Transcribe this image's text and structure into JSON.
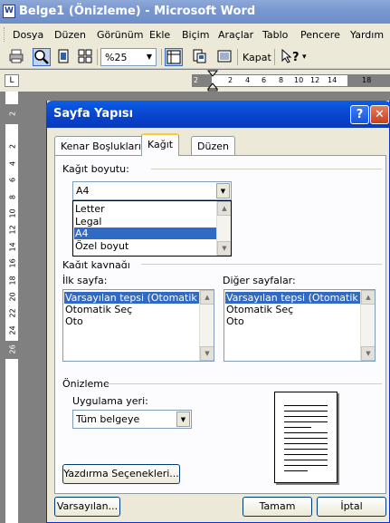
{
  "window": {
    "title": "Belge1 (Önizleme) - Microsoft Word",
    "icon": "word-app-icon"
  },
  "menu": [
    "Dosya",
    "Düzen",
    "Görünüm",
    "Ekle",
    "Biçim",
    "Araçlar",
    "Tablo",
    "Pencere",
    "Yardım"
  ],
  "toolbar": {
    "zoom": "%25",
    "close_label": "Kapat",
    "icons": [
      "print-icon",
      "magnifier-icon",
      "one-page-icon",
      "multiple-pages-icon",
      "view-ruler-icon",
      "shrink-to-fit-icon",
      "full-screen-icon",
      "context-help-icon"
    ]
  },
  "ruler": {
    "corner": "L",
    "numbers": [
      "2",
      "2",
      "4",
      "6",
      "8",
      "10",
      "12",
      "14",
      "18"
    ],
    "vnumbers": [
      "2",
      "2",
      "4",
      "6",
      "8",
      "10",
      "12",
      "14",
      "16",
      "18",
      "20",
      "22",
      "24",
      "26"
    ]
  },
  "dialog": {
    "title": "Sayfa Yapısı",
    "help": "?",
    "close": "✕",
    "tabs": [
      "Kenar Boşlukları",
      "Kağıt",
      "Düzen"
    ],
    "active_tab": "Kağıt",
    "paper_size_label": "Kağıt boyutu:",
    "paper_size_value": "A4",
    "paper_size_options": [
      "Letter",
      "Legal",
      "A4",
      "Özel boyut"
    ],
    "paper_size_selected": "A4",
    "paper_source_label": "Kağıt kaynağı",
    "first_page_label": "İlk sayfa:",
    "other_pages_label": "Diğer sayfalar:",
    "first_page_options": [
      "Varsayılan tepsi (Otomatik Seç)",
      "Otomatik Seç",
      "Oto"
    ],
    "other_pages_options": [
      "Varsayılan tepsi (Otomatik Seç)",
      "Otomatik Seç",
      "Oto"
    ],
    "preview_label": "Önizleme",
    "apply_to_label": "Uygulama yeri:",
    "apply_to_value": "Tüm belgeye",
    "print_options_button": "Yazdırma Seçenekleri...",
    "default_button": "Varsayılan...",
    "ok_button": "Tamam",
    "cancel_button": "İptal"
  }
}
